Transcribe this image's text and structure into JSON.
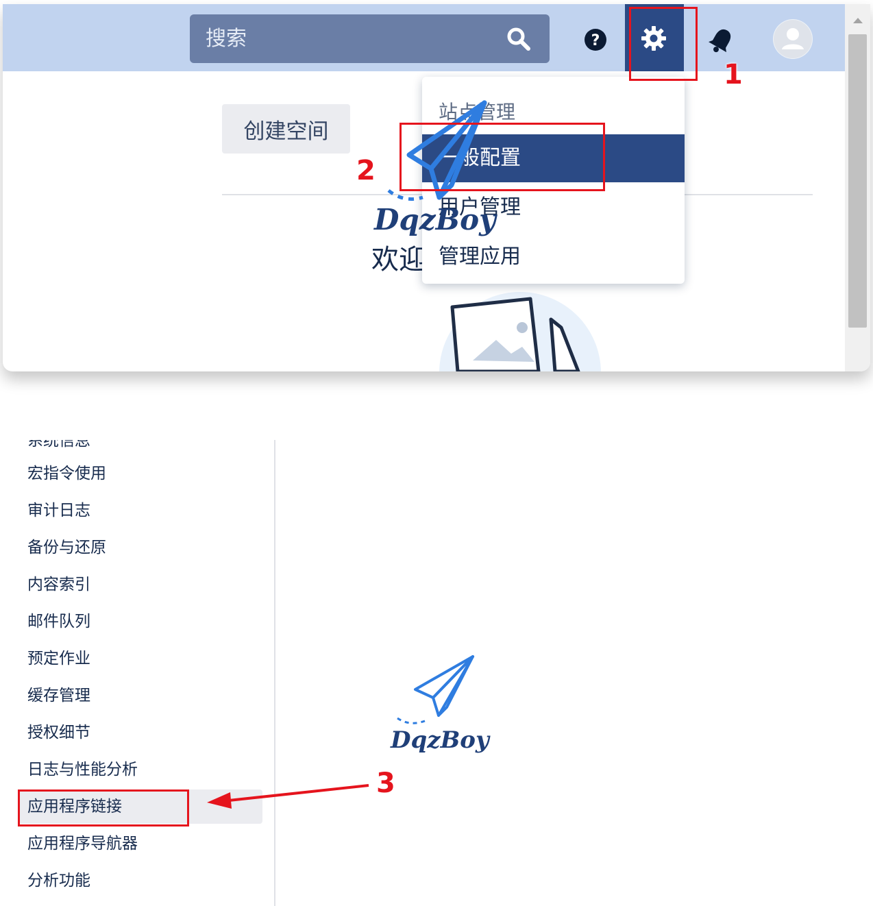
{
  "top": {
    "search": {
      "placeholder": "搜索"
    },
    "dropdown": {
      "heading": "站点管理",
      "items": [
        "一般配置",
        "用户管理",
        "管理应用"
      ],
      "active_index": 0
    },
    "create_space_label": "创建空间",
    "welcome_text": "欢迎"
  },
  "bottom": {
    "sidebar": {
      "partial_top_item": "系统信息",
      "items": [
        "宏指令使用",
        "审计日志",
        "备份与还原",
        "内容索引",
        "邮件队列",
        "预定作业",
        "缓存管理",
        "授权细节",
        "日志与性能分析",
        "应用程序链接",
        "应用程序导航器",
        "分析功能"
      ],
      "selected_index": 9
    }
  },
  "annotations": {
    "step1": "1",
    "step2": "2",
    "step3": "3",
    "color": "#e5141d"
  },
  "watermark": {
    "text": "DqzBoy",
    "color": "#2f7de0"
  },
  "colors": {
    "header_bg": "#c1d3ef",
    "search_bg": "#6a7ea6",
    "active_bg": "#2b4a85"
  }
}
